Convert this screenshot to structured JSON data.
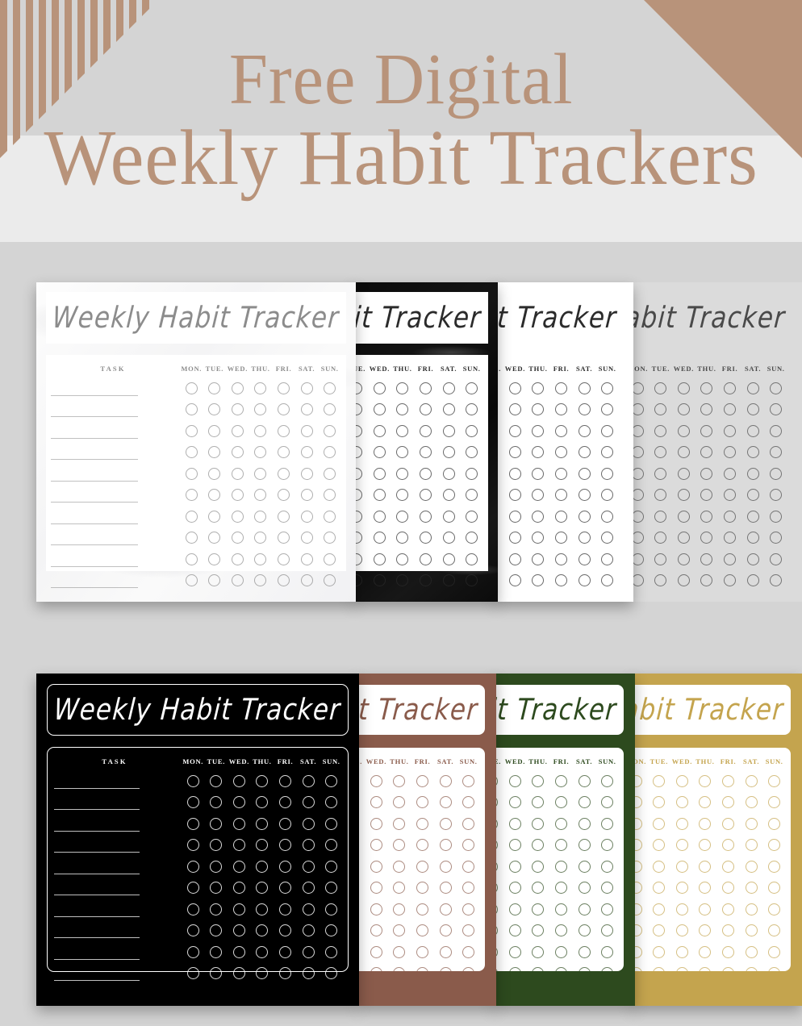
{
  "banner": {
    "line1": "Free Digital",
    "line2": "Weekly Habit Trackers",
    "accent_color": "#b8937a",
    "background_color": "#ebebeb",
    "page_background_color": "#d4d4d4",
    "decor": {
      "left_name": "striped-corner-decoration",
      "right_name": "triangle-corner-decoration",
      "stripe_count": 12
    }
  },
  "tracker": {
    "title": "Weekly Habit Tracker",
    "title_short": "Tracker",
    "title_partial_1": "t Tracker",
    "title_partial_2": "Tracker",
    "task_header": "TASK",
    "days": [
      "MON.",
      "TUE.",
      "WED.",
      "THU.",
      "FRI.",
      "SAT.",
      "SUN."
    ],
    "days_partial": [
      "WED.",
      "THU.",
      "FRI.",
      "SAT.",
      "SUN."
    ],
    "days_partial_wide": [
      "E.",
      "WED.",
      "THU.",
      "FRI.",
      "SAT.",
      "SUN."
    ],
    "rows": 10,
    "columns": 7
  },
  "rows": [
    {
      "name": "top-row",
      "cards": [
        {
          "name": "white-marble-tracker-card",
          "theme": "White Marble",
          "bg": "marble-white",
          "ink": "#8c8c8c",
          "plate_bg": "#ffffff",
          "full": true
        },
        {
          "name": "black-marble-tracker-card",
          "theme": "Black Marble",
          "bg": "marble-black",
          "ink": "#2b2b2b",
          "plate_bg": "#ffffff",
          "full": false
        },
        {
          "name": "white-plain-tracker-card",
          "theme": "White Plain",
          "bg": "#ffffff",
          "ink": "#2b2b2b",
          "plate_bg": "#ffffff",
          "full": false
        },
        {
          "name": "ghost-tracker-card",
          "theme": "Faded Grey",
          "bg": "ghost",
          "ink": "#4a4a4a",
          "plate_bg": "transparent",
          "full": false
        }
      ]
    },
    {
      "name": "bottom-row",
      "cards": [
        {
          "name": "black-tracker-card",
          "theme": "Black",
          "bg": "#000000",
          "ink": "#ffffff",
          "plate_bg": "#000000",
          "full": true
        },
        {
          "name": "terracotta-tracker-card",
          "theme": "Terracotta",
          "bg": "#8a5b4b",
          "ink": "#8a5b4b",
          "plate_bg": "#ffffff",
          "full": false
        },
        {
          "name": "forest-green-tracker-card",
          "theme": "Forest Green",
          "bg": "#2d4a1e",
          "ink": "#2d4a1e",
          "plate_bg": "#ffffff",
          "full": false
        },
        {
          "name": "gold-tracker-card",
          "theme": "Gold",
          "bg": "#c4a44e",
          "ink": "#c4a44e",
          "plate_bg": "#ffffff",
          "full": false
        }
      ]
    }
  ]
}
